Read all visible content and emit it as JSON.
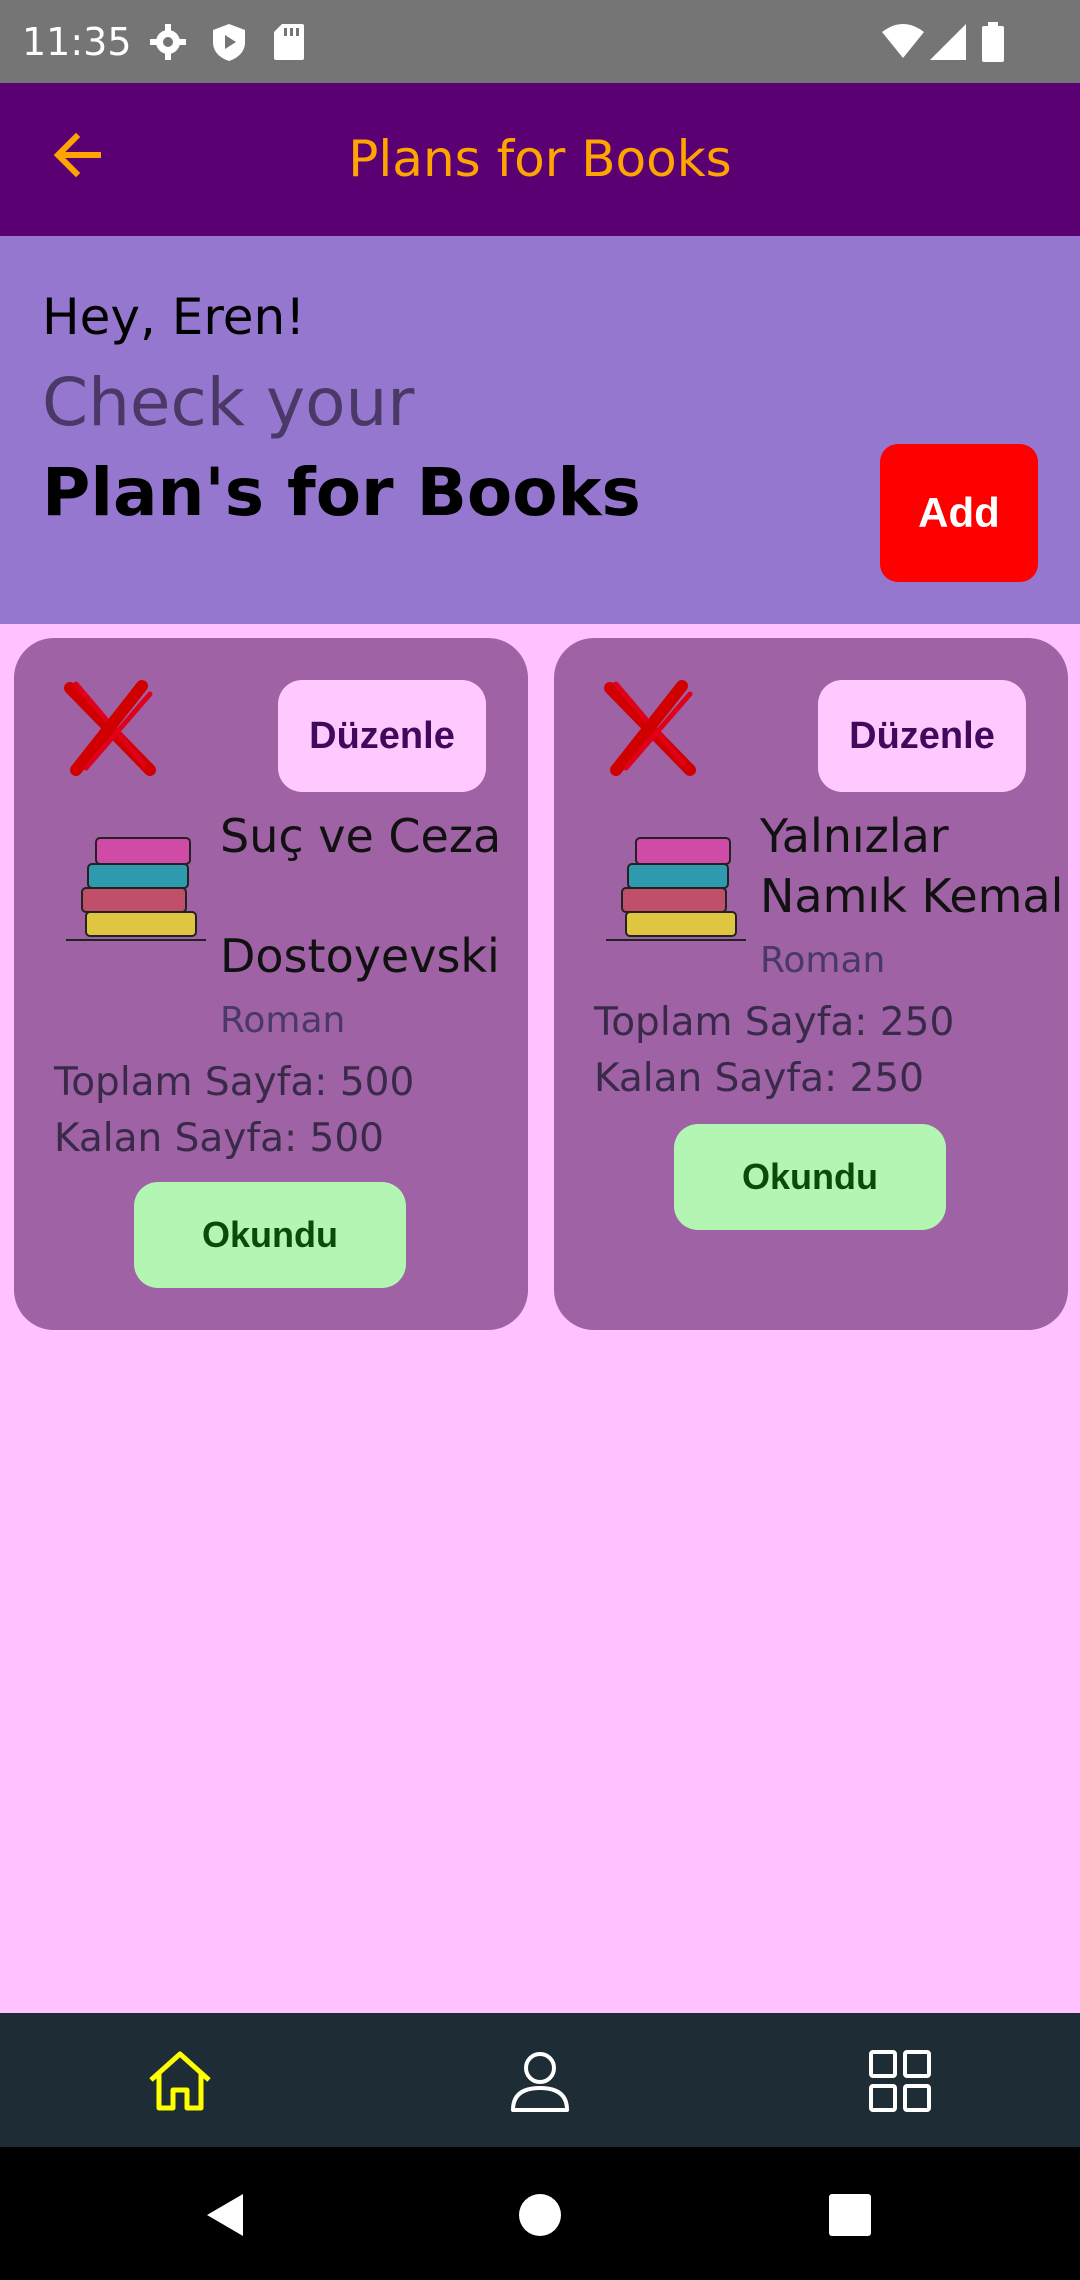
{
  "status_bar": {
    "time": "11:35",
    "icons": [
      "settings-icon",
      "shield-play-icon",
      "sd-card-icon",
      "wifi-icon",
      "cell-signal-icon",
      "battery-icon"
    ]
  },
  "app_bar": {
    "title": "Plans for Books",
    "back_icon": "arrow-back-icon",
    "title_color": "#FFA500",
    "background": "#5B0072"
  },
  "header": {
    "greeting": "Hey, Eren!",
    "subtitle": "Check your",
    "heading": "Plan's for Books",
    "add_label": "Add"
  },
  "books": [
    {
      "title": "Suç ve Ceza",
      "author": "Dostoyevski",
      "genre": "Roman",
      "total_pages": "Toplam Sayfa: 500",
      "remaining_pages": "Kalan Sayfa: 500",
      "edit_label": "Düzenle",
      "read_label": "Okundu"
    },
    {
      "title": "Yalnızlar",
      "author": "Namık Kemal",
      "genre": "Roman",
      "total_pages": "Toplam Sayfa: 250",
      "remaining_pages": "Kalan Sayfa: 250",
      "edit_label": "Düzenle",
      "read_label": "Okundu"
    }
  ],
  "bottom_nav": {
    "items": [
      {
        "icon": "home-icon",
        "active": true
      },
      {
        "icon": "person-icon",
        "active": false
      },
      {
        "icon": "grid-icon",
        "active": false
      }
    ],
    "active_color": "#FFFF00"
  },
  "system_nav": [
    "back-triangle-icon",
    "home-circle-icon",
    "recents-square-icon"
  ]
}
